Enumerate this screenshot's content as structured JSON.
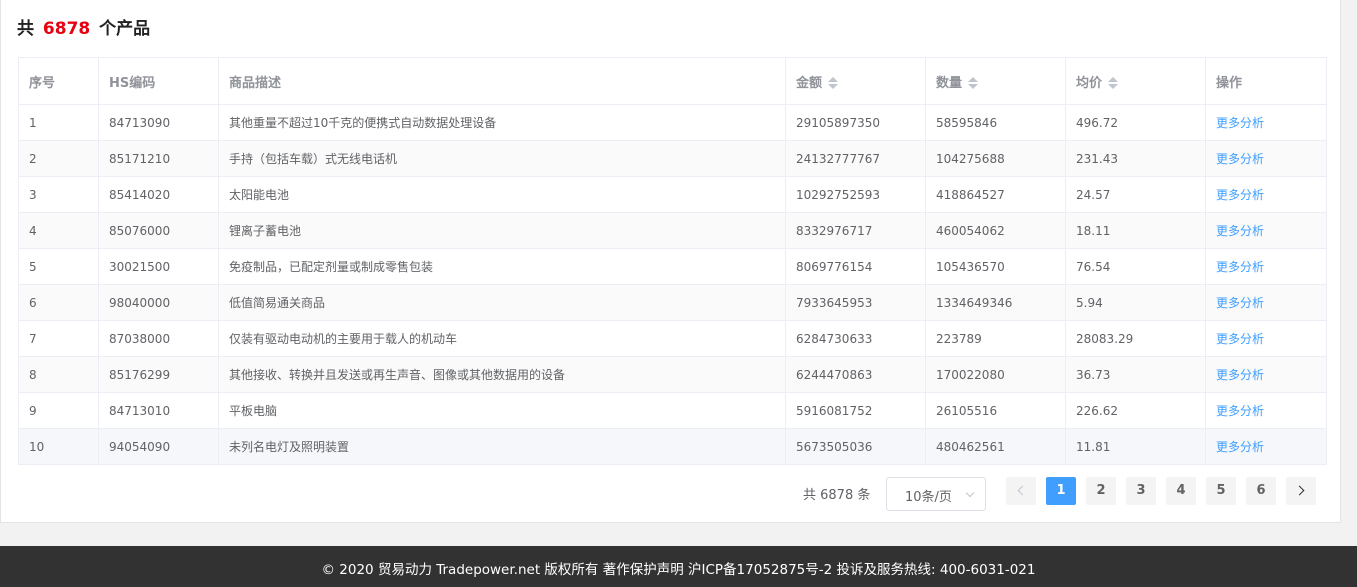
{
  "heading": {
    "prefix": "共",
    "count": "6878",
    "suffix": "个产品"
  },
  "columns": [
    "序号",
    "HS编码",
    "商品描述",
    "金额",
    "数量",
    "均价",
    "操作"
  ],
  "rows": [
    {
      "no": "1",
      "hs": "84713090",
      "desc": "其他重量不超过10千克的便携式自动数据处理设备",
      "amount": "29105897350",
      "qty": "58595846",
      "avg": "496.72",
      "action": "更多分析"
    },
    {
      "no": "2",
      "hs": "85171210",
      "desc": "手持（包括车载）式无线电话机",
      "amount": "24132777767",
      "qty": "104275688",
      "avg": "231.43",
      "action": "更多分析"
    },
    {
      "no": "3",
      "hs": "85414020",
      "desc": "太阳能电池",
      "amount": "10292752593",
      "qty": "418864527",
      "avg": "24.57",
      "action": "更多分析"
    },
    {
      "no": "4",
      "hs": "85076000",
      "desc": "锂离子蓄电池",
      "amount": "8332976717",
      "qty": "460054062",
      "avg": "18.11",
      "action": "更多分析"
    },
    {
      "no": "5",
      "hs": "30021500",
      "desc": "免疫制品，已配定剂量或制成零售包装",
      "amount": "8069776154",
      "qty": "105436570",
      "avg": "76.54",
      "action": "更多分析"
    },
    {
      "no": "6",
      "hs": "98040000",
      "desc": "低值简易通关商品",
      "amount": "7933645953",
      "qty": "1334649346",
      "avg": "5.94",
      "action": "更多分析"
    },
    {
      "no": "7",
      "hs": "87038000",
      "desc": "仅装有驱动电动机的主要用于载人的机动车",
      "amount": "6284730633",
      "qty": "223789",
      "avg": "28083.29",
      "action": "更多分析"
    },
    {
      "no": "8",
      "hs": "85176299",
      "desc": "其他接收、转换并且发送或再生声音、图像或其他数据用的设备",
      "amount": "6244470863",
      "qty": "170022080",
      "avg": "36.73",
      "action": "更多分析"
    },
    {
      "no": "9",
      "hs": "84713010",
      "desc": "平板电脑",
      "amount": "5916081752",
      "qty": "26105516",
      "avg": "226.62",
      "action": "更多分析"
    },
    {
      "no": "10",
      "hs": "94054090",
      "desc": "未列名电灯及照明装置",
      "amount": "5673505036",
      "qty": "480462561",
      "avg": "11.81",
      "action": "更多分析"
    }
  ],
  "pagination": {
    "total": "共 6878 条",
    "page_size": "10条/页",
    "pages": [
      "1",
      "2",
      "3",
      "4",
      "5",
      "6"
    ],
    "current": "1"
  },
  "footer": "© 2020 贸易动力 Tradepower.net 版权所有 著作保护声明 沪ICP备17052875号-2 投诉及服务热线: 400-6031-021",
  "colors": {
    "accent": "#409eff",
    "count": "#e60012",
    "footer_bg": "#323232"
  }
}
